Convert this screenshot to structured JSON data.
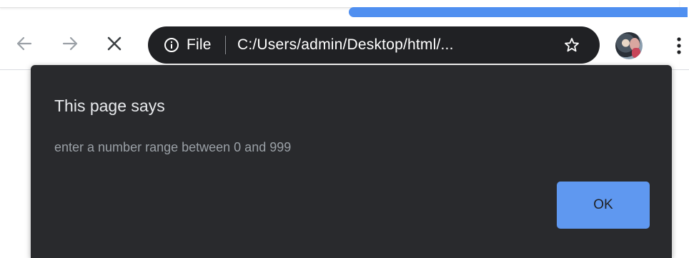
{
  "browser": {
    "omnibox": {
      "scheme_label": "File",
      "url": "C:/Users/admin/Desktop/html/..."
    },
    "icons": {
      "back": "arrow-left-icon",
      "forward": "arrow-right-icon",
      "stop": "close-icon",
      "info": "info-icon",
      "bookmark": "star-icon",
      "menu": "more-vertical-icon"
    },
    "colors": {
      "progress": "#4f8ff0",
      "omnibox_bg": "#202124"
    }
  },
  "dialog": {
    "title": "This page says",
    "message": "enter a number range between 0 and 999",
    "ok_label": "OK",
    "colors": {
      "background": "#292a2d",
      "button": "#5f98f0"
    }
  }
}
